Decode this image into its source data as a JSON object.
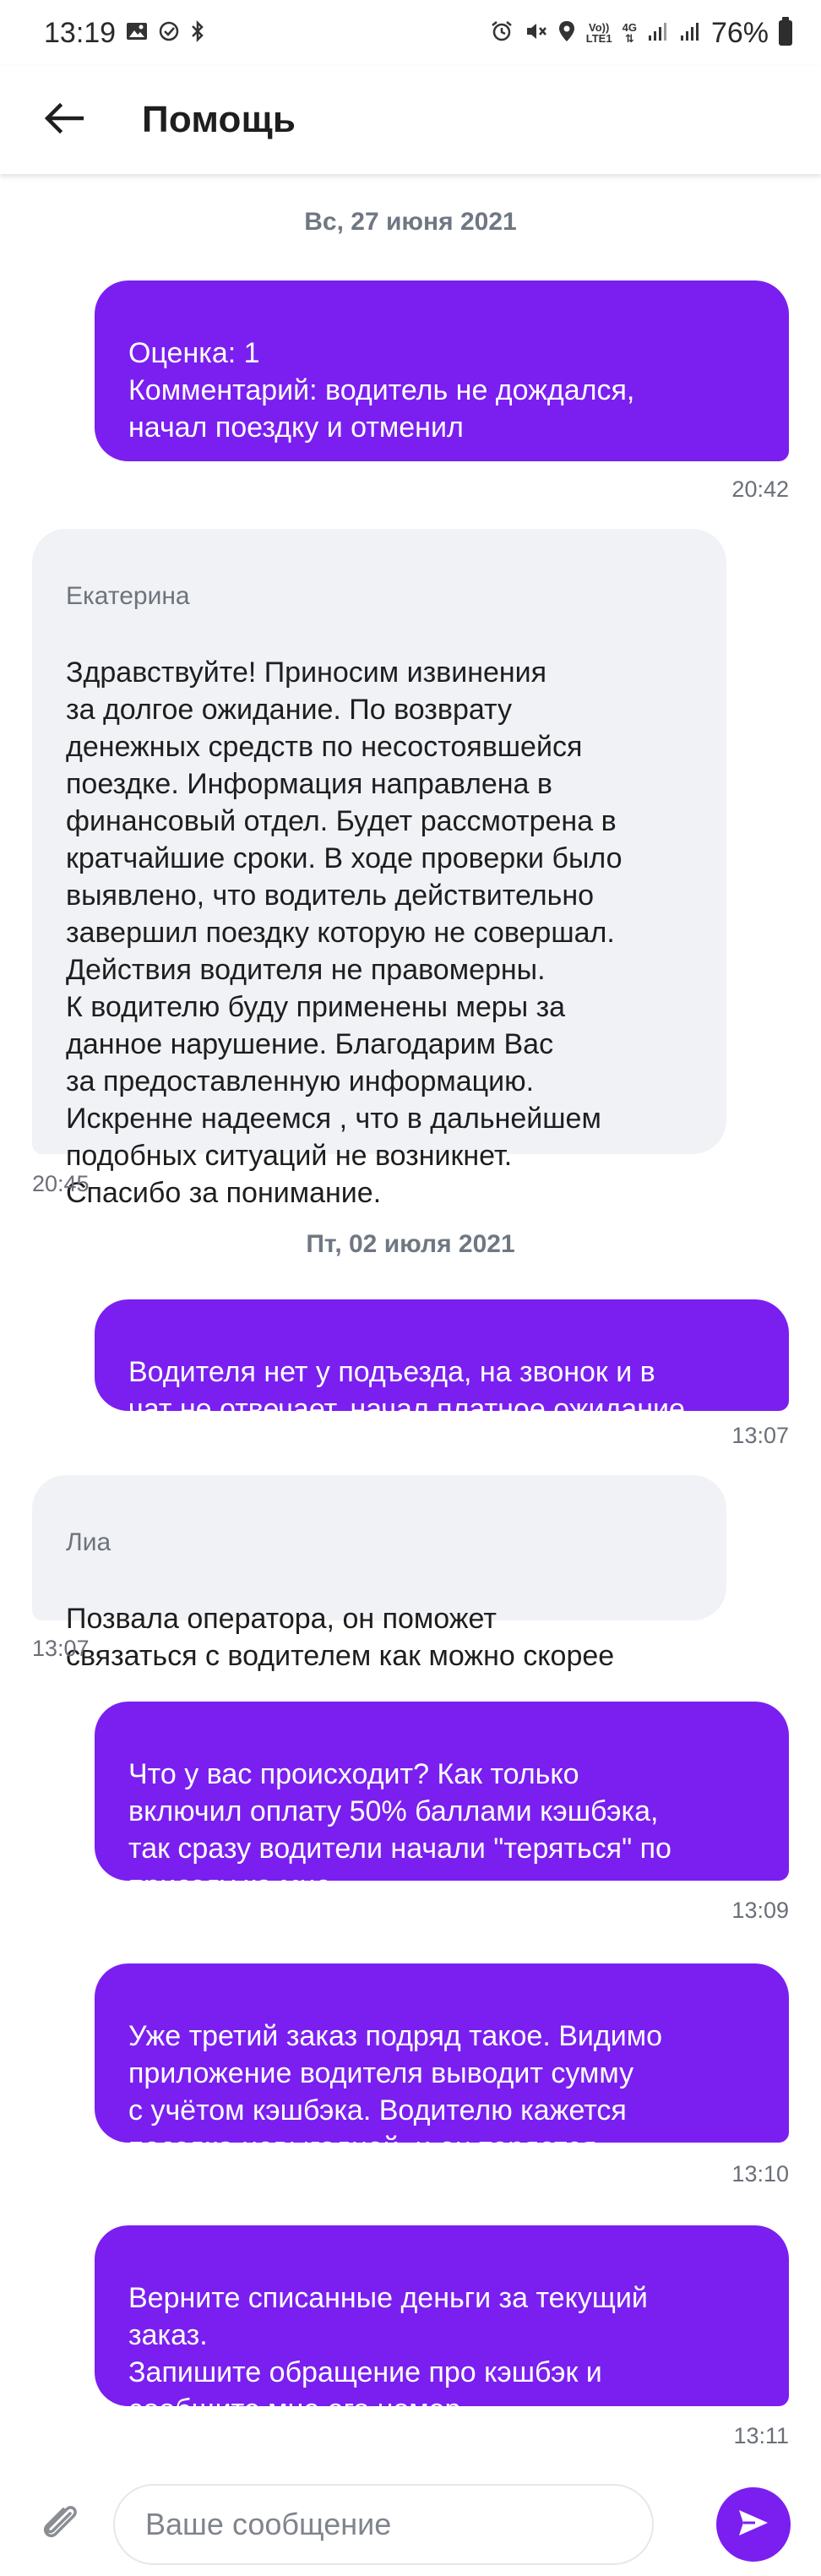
{
  "status_bar": {
    "time": "13:19",
    "network_volte": "Vo))\nLTE1",
    "network_4g": "4G",
    "battery_percent": "76%",
    "left_icons": [
      "gallery-icon",
      "sync-icon",
      "bluetooth-icon"
    ],
    "right_icons": [
      "alarm-icon",
      "mute-icon",
      "location-icon",
      "volte-icon",
      "4g-icon",
      "signal-icon",
      "signal-icon",
      "battery-icon"
    ]
  },
  "header": {
    "title": "Помощь",
    "back_icon": "arrow-left-icon"
  },
  "colors": {
    "accent": "#7a1ff0",
    "incoming_bubble": "#f1f2f6",
    "date_text": "#6f7782"
  },
  "chat": {
    "date_1": "Вс, 27 июня 2021",
    "msg_1": {
      "text": "Оценка: 1\nКомментарий: водитель не дождался,\nначал поездку и отменил",
      "time": "20:42"
    },
    "msg_2": {
      "sender": "Екатерина",
      "text": "Здравствуйте! Приносим извинения\nза долгое ожидание. По возврату\nденежных средств по несостоявшейся\nпоездке. Информация направлена в\nфинансовый отдел. Будет рассмотрена в\nкратчайшие сроки. В ходе проверки было\nвыявлено, что водитель действительно\nзавершил поездку которую не совершал.\nДействия водителя не правомерны.\nК водителю буду применены меры за\nданное нарушение. Благодарим Вас\nза предоставленную информацию.\nИскренне надеемся , что в дальнейшем\nподобных ситуаций не возникнет.\nСпасибо за понимание.",
      "time": "20:45"
    },
    "date_2": "Пт, 02 июля 2021",
    "msg_3": {
      "text": "Водителя нет у подъезда, на звонок и в\nчат не отвечает, начал платное ожидание",
      "time": "13:07"
    },
    "msg_4": {
      "sender": "Лиа",
      "text": "Позвала оператора, он поможет\nсвязаться с водителем как можно скорее",
      "time": "13:07"
    },
    "msg_5": {
      "text": "Что у вас происходит? Как только\nвключил оплату 50% баллами кэшбэка,\nтак сразу водители начали \"теряться\" по\nприезду ко мне.",
      "time": "13:09"
    },
    "msg_6": {
      "text": "Уже третий заказ подряд такое. Видимо\nприложение водителя выводит сумму\nс учётом кэшбэка. Водителю кажется\nпоездка невыгодной, и он теряется",
      "time": "13:10"
    },
    "msg_7": {
      "text": "Верните списанные деньги за текущий\nзаказ.\nЗапишите обращение про кэшбэк и\nсообщите мне его номер.",
      "time": "13:11"
    }
  },
  "composer": {
    "placeholder": "Ваше сообщение",
    "value": "",
    "attach_icon": "paperclip-icon",
    "send_icon": "send-icon"
  }
}
